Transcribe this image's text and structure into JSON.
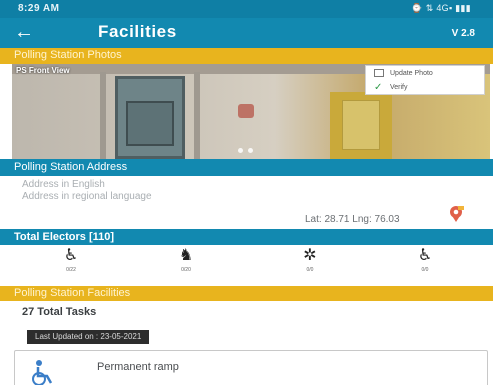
{
  "status_bar": {
    "time": "8:29 AM",
    "icons": "⌚ ⇅ 4G▪ ▮▮▮"
  },
  "app_bar": {
    "back_icon": "arrow-left-icon",
    "title": "Facilities",
    "version": "V 2.8"
  },
  "photos_section": {
    "title": "Polling Station Photos",
    "photo_label": "PS Front View"
  },
  "photo_menu": {
    "update_label": "Update Photo",
    "verify_label": "Verify"
  },
  "address_section": {
    "title": "Polling Station Address",
    "line_english": "Address in English",
    "line_regional": "Address in regional language",
    "coordinates": "Lat: 28.71  Lng: 76.03"
  },
  "electors_section": {
    "title": "Total Electors [110]",
    "categories": [
      {
        "icon": "pwd-wheelchair-user-icon",
        "count": "0/22"
      },
      {
        "icon": "senior-citizen-icon",
        "count": "0/20"
      },
      {
        "icon": "blind-person-icon",
        "count": "0/0"
      },
      {
        "icon": "wheelchair-icon",
        "count": "0/0"
      }
    ]
  },
  "facilities_section": {
    "title": "Polling Station Facilities",
    "total_tasks": "27 Total Tasks",
    "last_updated": "Last Updated on : 23-05-2021"
  },
  "task_card": {
    "icon": "wheelchair-ramp-icon",
    "name": "Permanent ramp"
  },
  "colors": {
    "primary": "#1289b0",
    "accent": "#e8b41e",
    "status": "#0f7fa5"
  }
}
